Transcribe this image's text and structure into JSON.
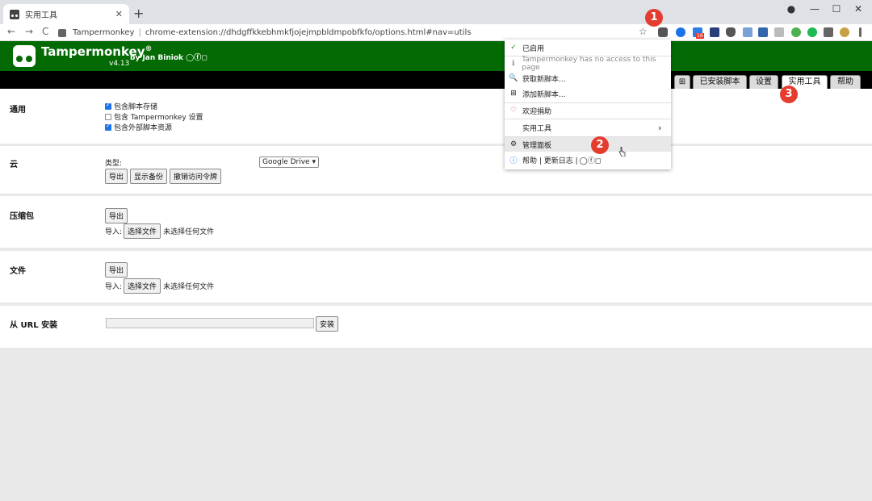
{
  "browser": {
    "tab_title": "实用工具",
    "tab_close": "✕",
    "new_tab": "+",
    "back": "←",
    "forward": "→",
    "reload": "C",
    "url_site": "Tampermonkey",
    "url_sep": "|",
    "url_path": "chrome-extension://dhdgffkkebhmkfjojejmpbldmpobfkfo/options.html#nav=utils",
    "star": "☆",
    "profile_icon": "●",
    "minimize": "—",
    "maximize": "☐",
    "close": "✕"
  },
  "extensions": {
    "badge_count": "16"
  },
  "annotations": {
    "a1": "1",
    "a2": "2",
    "a3": "3"
  },
  "header": {
    "name": "Tampermonkey",
    "reg": "®",
    "by": "by Jan Biniok",
    "social": "◯ⓕ◻",
    "version": "v4.13"
  },
  "nav_tabs": [
    {
      "label": "⊞"
    },
    {
      "label": "已安装脚本"
    },
    {
      "label": "设置"
    },
    {
      "label": "实用工具"
    },
    {
      "label": "帮助"
    }
  ],
  "general": {
    "title": "通用",
    "options": [
      {
        "label": "包含脚本存储",
        "checked": true
      },
      {
        "label": "包含 Tampermonkey 设置",
        "checked": false
      },
      {
        "label": "包含外部脚本资源",
        "checked": true
      }
    ]
  },
  "cloud": {
    "title": "云",
    "type_label": "类型:",
    "type_value": "Google Drive ▾",
    "export": "导出",
    "show_backup": "显示备份",
    "revoke_token": "撤销访问令牌"
  },
  "zip": {
    "title": "压缩包",
    "export": "导出",
    "import_label": "导入:",
    "choose_file": "选择文件",
    "no_file": "未选择任何文件"
  },
  "file": {
    "title": "文件",
    "export": "导出",
    "import_label": "导入:",
    "choose_file": "选择文件",
    "no_file": "未选择任何文件"
  },
  "url_install": {
    "title": "从 URL 安装",
    "input_value": "",
    "install": "安装"
  },
  "menu": {
    "enabled": "已启用",
    "no_access": "Tampermonkey has no access to this page",
    "get_scripts": "获取新脚本...",
    "add_script": "添加新脚本...",
    "donate": "欢迎捐助",
    "utilities": "实用工具",
    "dashboard": "管理面板",
    "help_line": "帮助 | 更新日志 |",
    "help_social": "◯ⓕ◻",
    "icon_check": "✓",
    "icon_info": "ℹ",
    "icon_search": "🔍",
    "icon_add": "⊞",
    "icon_heart": "♡",
    "icon_gear": "⚙",
    "icon_help": "ⓘ",
    "chevron": "›"
  }
}
